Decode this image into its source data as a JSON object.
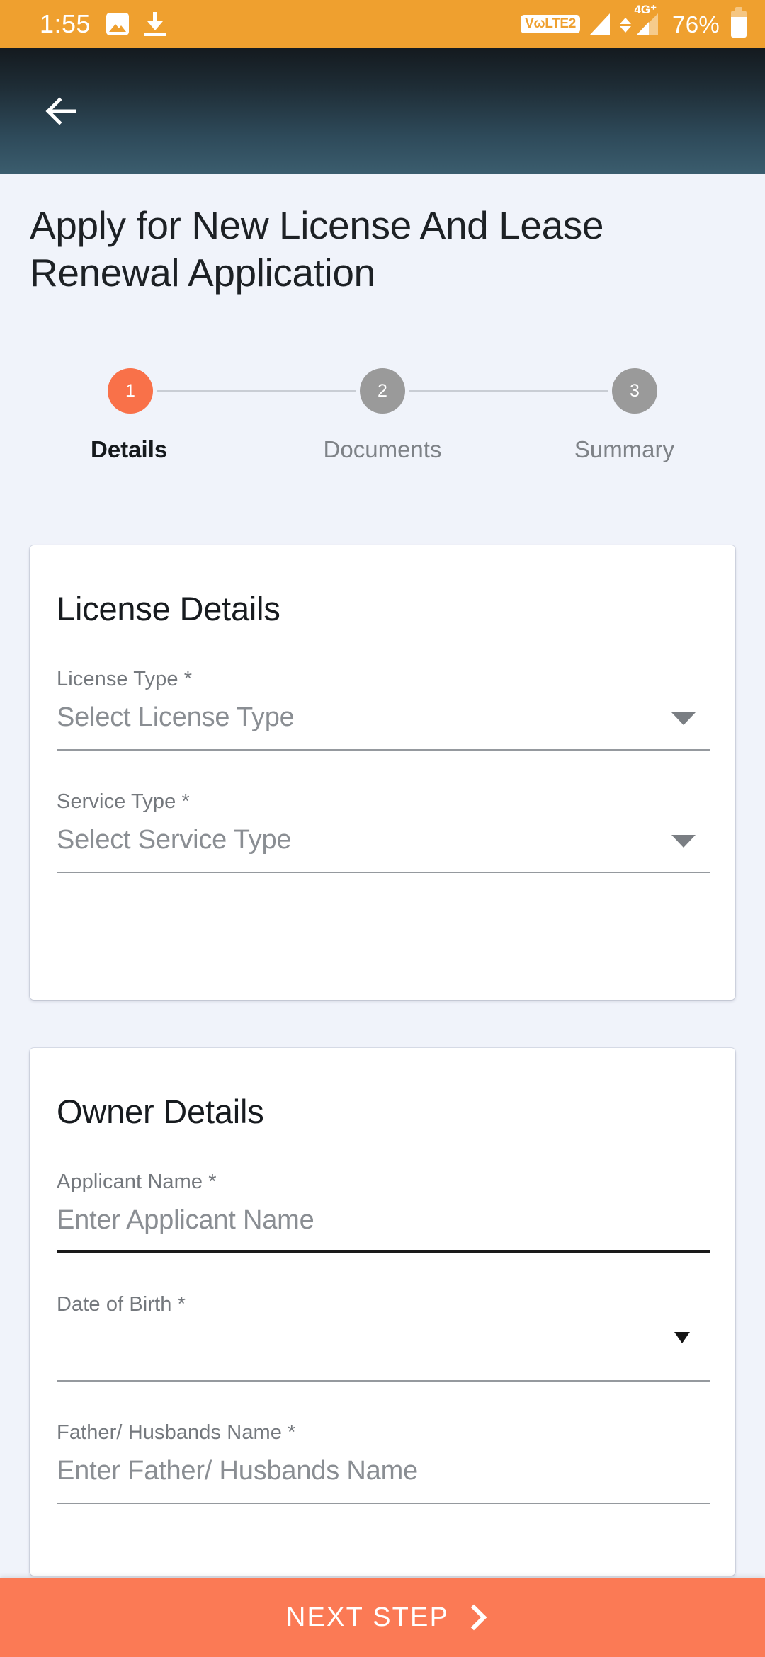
{
  "status_bar": {
    "time": "1:55",
    "photo_icon": "photo-icon",
    "download_icon": "download-icon",
    "volte_label": "VωLTE2",
    "network_label": "4G⁺",
    "battery_percent": "76%",
    "background_color": "#EFA02F"
  },
  "app_bar": {
    "back_icon": "arrow-left-icon",
    "gradient_top": "#141A1F",
    "gradient_bottom": "#3B5D6E"
  },
  "page": {
    "title": "Apply for New License And Lease Renewal Application",
    "background_color": "#F0F3FA"
  },
  "stepper": {
    "active_color": "#F97149",
    "inactive_color": "#9A9A9A",
    "steps": [
      {
        "number": "1",
        "label": "Details",
        "state": "active"
      },
      {
        "number": "2",
        "label": "Documents",
        "state": "inactive"
      },
      {
        "number": "3",
        "label": "Summary",
        "state": "inactive"
      }
    ]
  },
  "cards": [
    {
      "title": "License Details",
      "fields": [
        {
          "label": "License Type *",
          "value": "Select License Type",
          "type": "dropdown",
          "focused": false
        },
        {
          "label": "Service Type *",
          "value": "Select Service Type",
          "type": "dropdown",
          "focused": false
        }
      ]
    },
    {
      "title": "Owner Details",
      "fields": [
        {
          "label": "Applicant Name *",
          "value": "Enter Applicant Name",
          "type": "text",
          "focused": true
        },
        {
          "label": "Date of Birth *",
          "value": "",
          "type": "date",
          "focused": false
        },
        {
          "label": "Father/ Husbands Name *",
          "value": "Enter Father/ Husbands Name",
          "type": "text",
          "focused": false
        }
      ]
    }
  ],
  "bottom_bar": {
    "label": "NEXT STEP",
    "chevron_icon": "chevron-right-icon",
    "background_color": "#FB7A55"
  }
}
